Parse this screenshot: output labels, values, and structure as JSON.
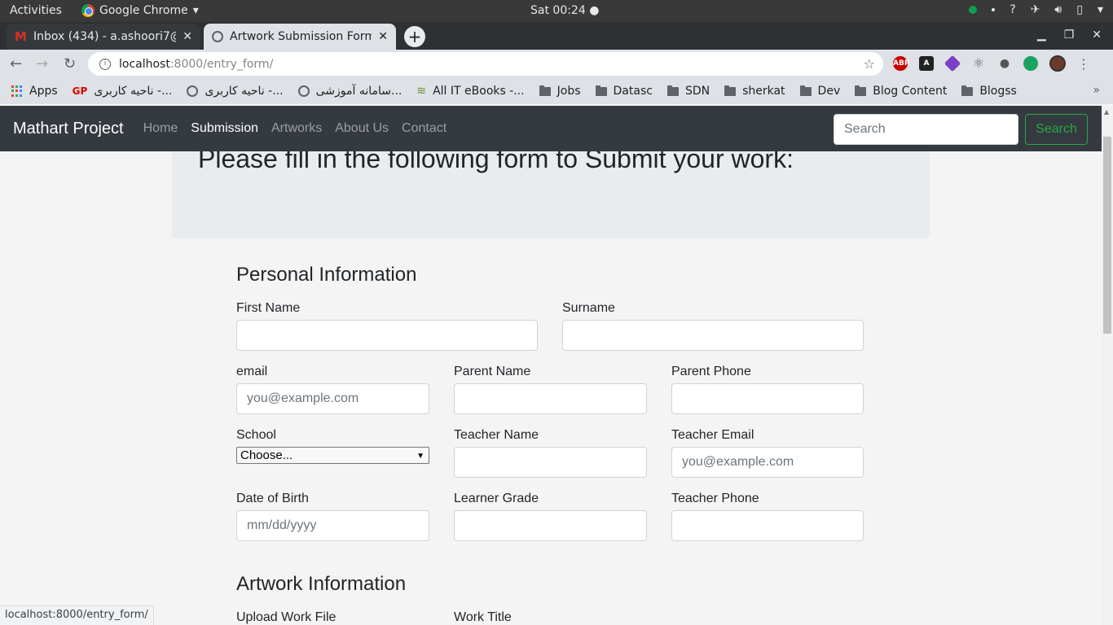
{
  "os": {
    "activities": "Activities",
    "app_name": "Google Chrome",
    "clock": "Sat 00:24"
  },
  "tabs": [
    {
      "title": "Inbox (434) - a.ashoori7@",
      "active": false
    },
    {
      "title": "Artwork Submission Form",
      "active": true
    }
  ],
  "address": {
    "host": "localhost",
    "path": ":8000/entry_form/"
  },
  "bookmarks": [
    {
      "label": "Apps"
    },
    {
      "label": "ناحیه کاربری -..."
    },
    {
      "label": "ناحیه کاربری -..."
    },
    {
      "label": "سامانه آموزشی..."
    },
    {
      "label": "All IT eBooks -..."
    },
    {
      "label": "Jobs"
    },
    {
      "label": "Datasc"
    },
    {
      "label": "SDN"
    },
    {
      "label": "sherkat"
    },
    {
      "label": "Dev"
    },
    {
      "label": "Blog Content"
    },
    {
      "label": "Blogss"
    }
  ],
  "navbar": {
    "brand": "Mathart Project",
    "links": [
      "Home",
      "Submission",
      "Artworks",
      "About Us",
      "Contact"
    ],
    "active_link": "Submission",
    "search_placeholder": "Search",
    "search_button": "Search"
  },
  "jumbotron": {
    "heading": "Please fill in the following form to Submit your work:"
  },
  "form": {
    "personal_title": "Personal Information",
    "first_name": "First Name",
    "surname": "Surname",
    "email": "email",
    "email_placeholder": "you@example.com",
    "parent_name": "Parent Name",
    "parent_phone": "Parent Phone",
    "school": "School",
    "school_selected": "Choose...",
    "teacher_name": "Teacher Name",
    "teacher_email": "Teacher Email",
    "teacher_email_placeholder": "you@example.com",
    "dob": "Date of Birth",
    "dob_placeholder": "mm/dd/yyyy",
    "learner_grade": "Learner Grade",
    "teacher_phone": "Teacher Phone",
    "artwork_title": "Artwork Information",
    "upload_work": "Upload Work File",
    "work_title": "Work Title"
  },
  "status_url": "localhost:8000/entry_form/",
  "colors": {
    "navbar": "#343a40",
    "jumbotron": "#e9ecef",
    "search_green": "#28a745"
  }
}
